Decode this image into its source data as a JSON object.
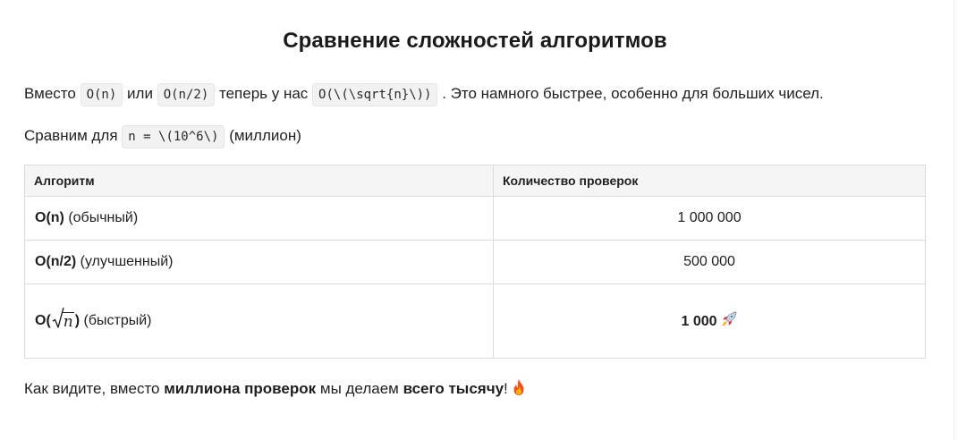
{
  "title": "Сравнение сложностей алгоритмов",
  "intro": {
    "prefix": "Вместо",
    "code1": "O(n)",
    "mid1": "или",
    "code2": "O(n/2)",
    "mid2": "теперь у нас",
    "code3": "O(\\(\\sqrt{n}\\))",
    "suffix": ". Это намного быстрее, особенно для больших чисел."
  },
  "compare": {
    "prefix": "Сравним для",
    "code": "n = \\(10^6\\)",
    "suffix": "(миллион)"
  },
  "table": {
    "headers": [
      "Алгоритм",
      "Количество проверок"
    ],
    "rows": [
      {
        "name_bold": "O(n)",
        "name_note": "(обычный)",
        "value": "1 000 000"
      },
      {
        "name_bold": "O(n/2)",
        "name_note": "(улучшенный)",
        "value": "500 000"
      },
      {
        "name_bold_open": "O(",
        "name_sqrt": "n",
        "name_bold_close": ")",
        "name_note": "(быстрый)",
        "value": "1 000",
        "value_icon": "rocket-icon"
      }
    ]
  },
  "conclusion": {
    "prefix": "Как видите, вместо",
    "bold1": "миллиона проверок",
    "mid": "мы делаем",
    "bold2": "всего тысячу",
    "suffix": "!",
    "icon": "fire-icon"
  }
}
